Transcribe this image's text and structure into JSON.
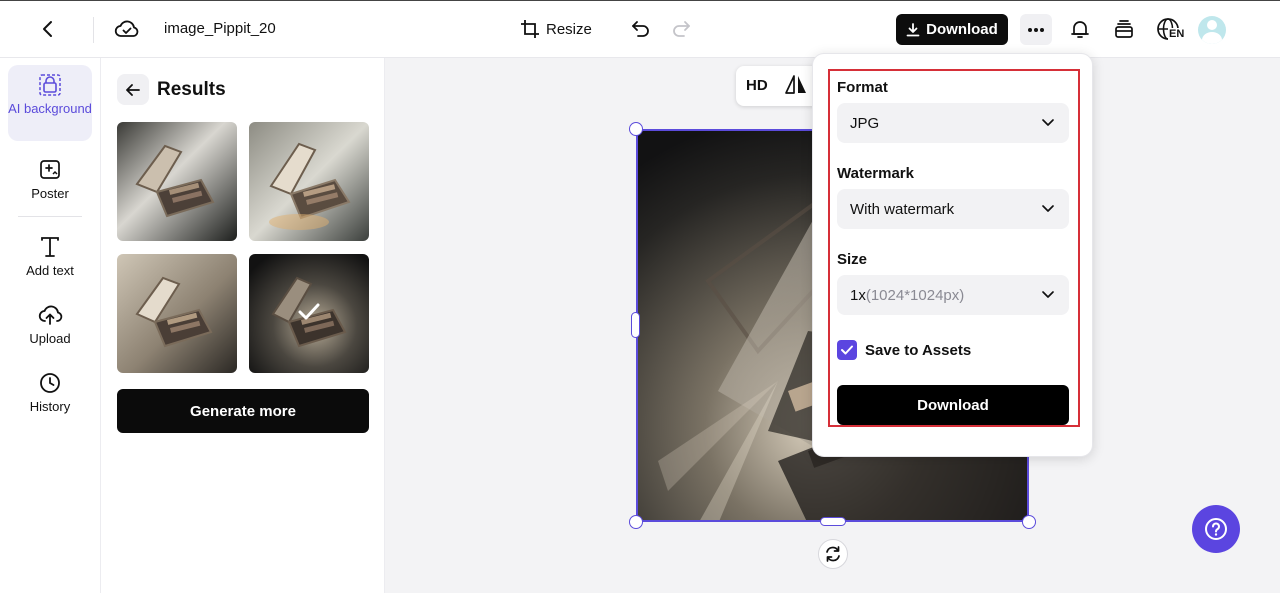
{
  "header": {
    "doc_title": "image_Pippit_20",
    "resize_label": "Resize",
    "download_label": "Download",
    "language": "EN"
  },
  "sidebar": {
    "items": [
      {
        "label": "AI background",
        "icon": "ai-background-icon",
        "active": true
      },
      {
        "label": "Poster",
        "icon": "poster-icon"
      },
      {
        "label": "Add text",
        "icon": "text-icon"
      },
      {
        "label": "Upload",
        "icon": "upload-icon"
      },
      {
        "label": "History",
        "icon": "history-icon"
      }
    ]
  },
  "results": {
    "title": "Results",
    "generate_label": "Generate more",
    "selected_index": 3
  },
  "canvas": {
    "hd_label": "HD"
  },
  "download_panel": {
    "format_label": "Format",
    "format_value": "JPG",
    "watermark_label": "Watermark",
    "watermark_value": "With watermark",
    "size_label": "Size",
    "size_value": "1x",
    "size_detail": "(1024*1024px)",
    "save_assets_label": "Save to Assets",
    "save_assets_checked": true,
    "download_label": "Download"
  },
  "colors": {
    "accent": "#5b45e0",
    "highlight": "#d62f38",
    "primary_button": "#0b0b0b"
  }
}
